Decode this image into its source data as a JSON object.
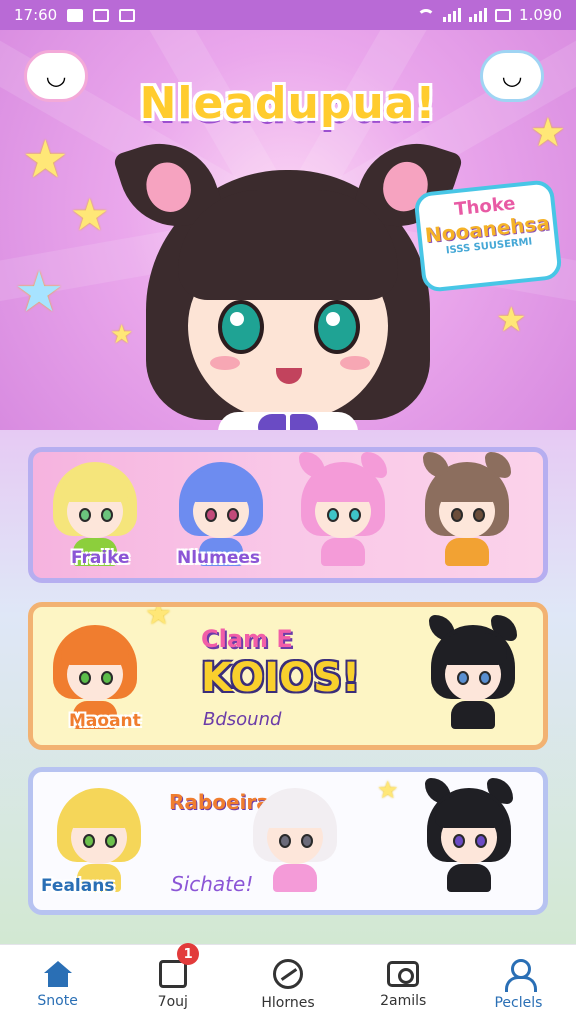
{
  "status_bar": {
    "time": "17:60",
    "right_text": "1.090",
    "accent": "#b96ad6"
  },
  "hero": {
    "title": "Nleadupua!",
    "bubble": {
      "line1": "Thoke",
      "line2": "Nooanehsa",
      "line3": "ISSS SUUSERMI"
    },
    "left_badge_icon": "smiling-cloud-icon",
    "right_badge_icon": "smiling-cloud-icon"
  },
  "cards": {
    "row1": {
      "names": [
        "Fraike",
        "Nlumees"
      ],
      "characters": [
        {
          "hair": "#f5e57b",
          "accent": "#8ccf3c",
          "eyes": "#6bc47d"
        },
        {
          "hair": "#6d8cf0",
          "accent": "#6d8cf0",
          "eyes": "#c24a7a"
        },
        {
          "hair": "#f49bd8",
          "accent": "#f49bd8",
          "eyes": "#3ec4c8"
        },
        {
          "hair": "#8c6e5e",
          "accent": "#f2a233",
          "eyes": "#6b4d3a"
        }
      ]
    },
    "row2": {
      "name": "Maoant",
      "promo_top": "Clam E",
      "promo_main": "KOIOS!",
      "promo_sub": "Bdsound",
      "characters": [
        {
          "hair": "#f07d2f",
          "accent": "#f07d2f",
          "eyes": "#5cbd4a"
        },
        {
          "hair": "#1f1f24",
          "accent": "#1f1f24",
          "eyes": "#5a8fd0"
        }
      ]
    },
    "row3": {
      "name": "Fealans",
      "center_top": "Raboeira",
      "center_sub": "Sichate!",
      "characters": [
        {
          "hair": "#f5d659",
          "accent": "#f5d659",
          "eyes": "#6cc04c"
        },
        {
          "hair": "#f2eef2",
          "accent": "#f49bd8",
          "eyes": "#6b6b7a"
        },
        {
          "hair": "#1f1f24",
          "accent": "#1f1f24",
          "eyes": "#6a4bc4"
        }
      ]
    }
  },
  "bottom_nav": {
    "items": [
      {
        "label": "Snote",
        "icon": "home-icon",
        "active": true
      },
      {
        "label": "7ouj",
        "icon": "square-icon",
        "badge": "1"
      },
      {
        "label": "Hlornes",
        "icon": "compass-icon"
      },
      {
        "label": "2amils",
        "icon": "camera-icon"
      },
      {
        "label": "Peclels",
        "icon": "person-icon",
        "active": true
      }
    ]
  }
}
